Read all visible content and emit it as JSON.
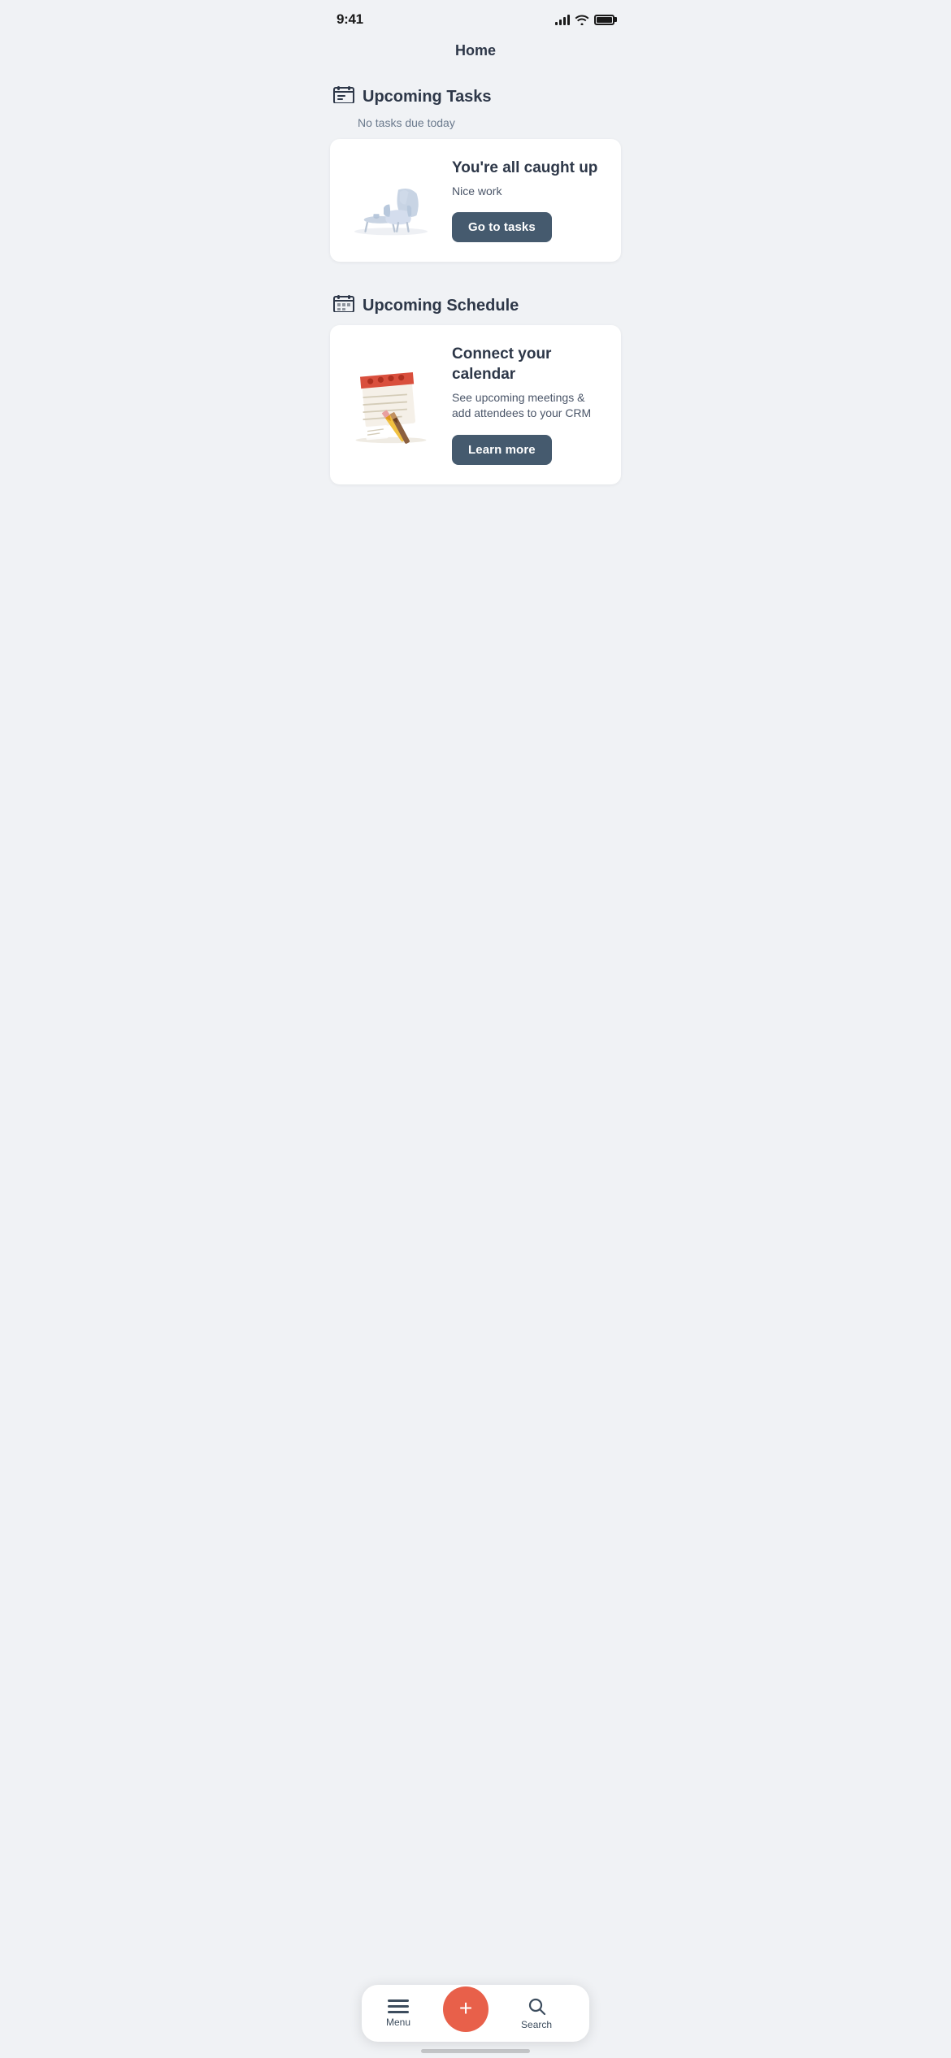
{
  "statusBar": {
    "time": "9:41"
  },
  "header": {
    "title": "Home"
  },
  "sections": [
    {
      "id": "tasks",
      "icon": "🗒",
      "title": "Upcoming Tasks",
      "subtitle": "No tasks due today",
      "card": {
        "heading": "You're all caught up",
        "description": "Nice work",
        "buttonLabel": "Go to tasks"
      }
    },
    {
      "id": "schedule",
      "icon": "📅",
      "title": "Upcoming Schedule",
      "card": {
        "heading": "Connect your calendar",
        "description": "See upcoming meetings & add attendees to your CRM",
        "buttonLabel": "Learn more"
      }
    }
  ],
  "bottomNav": {
    "menuLabel": "Menu",
    "searchLabel": "Search"
  }
}
